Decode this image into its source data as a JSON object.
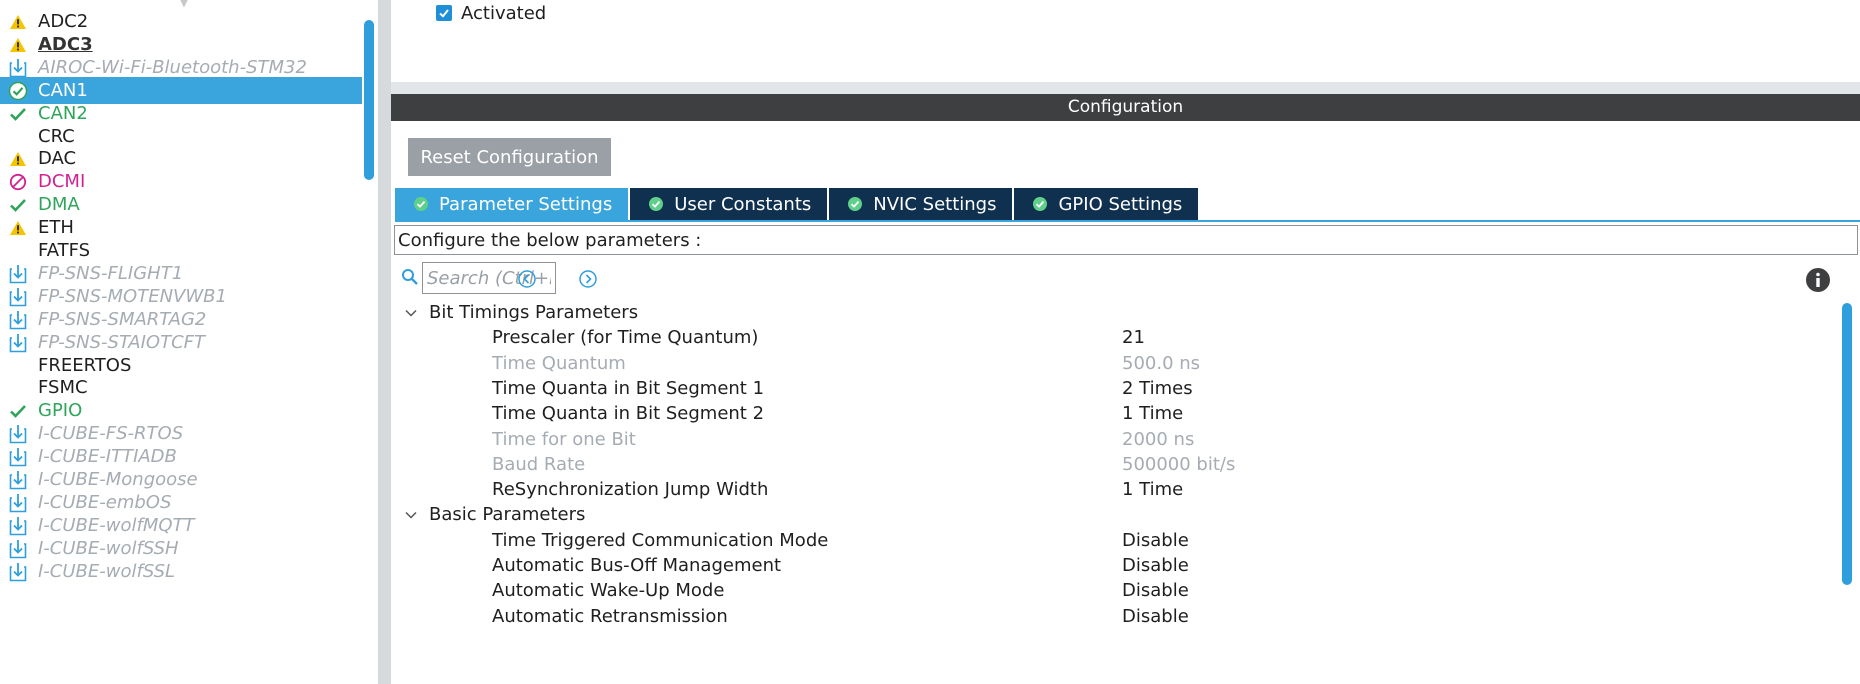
{
  "peripherals": [
    {
      "label": "ADC2",
      "icon": "warning-icon",
      "status": "warning"
    },
    {
      "label": "ADC3",
      "icon": "warning-icon",
      "status": "warning",
      "underlined": true
    },
    {
      "label": "AIROC-Wi-Fi-Bluetooth-STM32",
      "icon": "download-pack-icon",
      "status": "pack"
    },
    {
      "label": "CAN1",
      "icon": "check-circle-icon",
      "status": "ok",
      "selected": true
    },
    {
      "label": "CAN2",
      "icon": "check-icon",
      "status": "ok"
    },
    {
      "label": "CRC",
      "icon": "",
      "status": "none"
    },
    {
      "label": "DAC",
      "icon": "warning-icon",
      "status": "warning"
    },
    {
      "label": "DCMI",
      "icon": "disabled-icon",
      "status": "disabled"
    },
    {
      "label": "DMA",
      "icon": "check-icon",
      "status": "ok"
    },
    {
      "label": "ETH",
      "icon": "warning-icon",
      "status": "warning"
    },
    {
      "label": "FATFS",
      "icon": "",
      "status": "none"
    },
    {
      "label": "FP-SNS-FLIGHT1",
      "icon": "download-pack-icon",
      "status": "pack"
    },
    {
      "label": "FP-SNS-MOTENVWB1",
      "icon": "download-pack-icon",
      "status": "pack"
    },
    {
      "label": "FP-SNS-SMARTAG2",
      "icon": "download-pack-icon",
      "status": "pack"
    },
    {
      "label": "FP-SNS-STAIOTCFT",
      "icon": "download-pack-icon",
      "status": "pack"
    },
    {
      "label": "FREERTOS",
      "icon": "",
      "status": "none"
    },
    {
      "label": "FSMC",
      "icon": "",
      "status": "none"
    },
    {
      "label": "GPIO",
      "icon": "check-icon",
      "status": "ok"
    },
    {
      "label": "I-CUBE-FS-RTOS",
      "icon": "download-pack-icon",
      "status": "pack"
    },
    {
      "label": "I-CUBE-ITTIADB",
      "icon": "download-pack-icon",
      "status": "pack"
    },
    {
      "label": "I-CUBE-Mongoose",
      "icon": "download-pack-icon",
      "status": "pack"
    },
    {
      "label": "I-CUBE-embOS",
      "icon": "download-pack-icon",
      "status": "pack"
    },
    {
      "label": "I-CUBE-wolfMQTT",
      "icon": "download-pack-icon",
      "status": "pack"
    },
    {
      "label": "I-CUBE-wolfSSH",
      "icon": "download-pack-icon",
      "status": "pack"
    },
    {
      "label": "I-CUBE-wolfSSL",
      "icon": "download-pack-icon",
      "status": "pack"
    }
  ],
  "mode": {
    "activated_label": "Activated",
    "activated_checked": true
  },
  "configuration": {
    "header": "Configuration",
    "reset_label": "Reset Configuration",
    "tabs": [
      {
        "label": "Parameter Settings",
        "icon": "check-badge-icon",
        "active": true
      },
      {
        "label": "User Constants",
        "icon": "check-badge-icon",
        "active": false
      },
      {
        "label": "NVIC Settings",
        "icon": "check-badge-icon",
        "active": false
      },
      {
        "label": "GPIO Settings",
        "icon": "check-badge-icon",
        "active": false
      }
    ],
    "configure_text": "Configure the below parameters :",
    "search_placeholder": "Search (Ctrl+F)",
    "groups": [
      {
        "label": "Bit Timings Parameters",
        "expanded": true,
        "params": [
          {
            "name": "Prescaler (for Time Quantum)",
            "value": "21",
            "readonly": false
          },
          {
            "name": "Time Quantum",
            "value": "500.0 ns",
            "readonly": true
          },
          {
            "name": "Time Quanta in Bit Segment 1",
            "value": "2 Times",
            "readonly": false
          },
          {
            "name": "Time Quanta in Bit Segment 2",
            "value": "1 Time",
            "readonly": false
          },
          {
            "name": "Time for one Bit",
            "value": "2000 ns",
            "readonly": true
          },
          {
            "name": "Baud Rate",
            "value": "500000 bit/s",
            "readonly": true
          },
          {
            "name": "ReSynchronization Jump Width",
            "value": "1 Time",
            "readonly": false
          }
        ]
      },
      {
        "label": "Basic Parameters",
        "expanded": true,
        "params": [
          {
            "name": "Time Triggered Communication Mode",
            "value": "Disable",
            "readonly": false
          },
          {
            "name": "Automatic Bus-Off Management",
            "value": "Disable",
            "readonly": false
          },
          {
            "name": "Automatic Wake-Up Mode",
            "value": "Disable",
            "readonly": false
          },
          {
            "name": "Automatic Retransmission",
            "value": "Disable",
            "readonly": false
          }
        ]
      }
    ]
  },
  "colors": {
    "accent": "#3aa4dc",
    "tab_dark": "#10304f",
    "ok": "#2fa55a",
    "warning": "#f5c400",
    "disabled": "#d3218f",
    "pack": "#a6acb3"
  }
}
